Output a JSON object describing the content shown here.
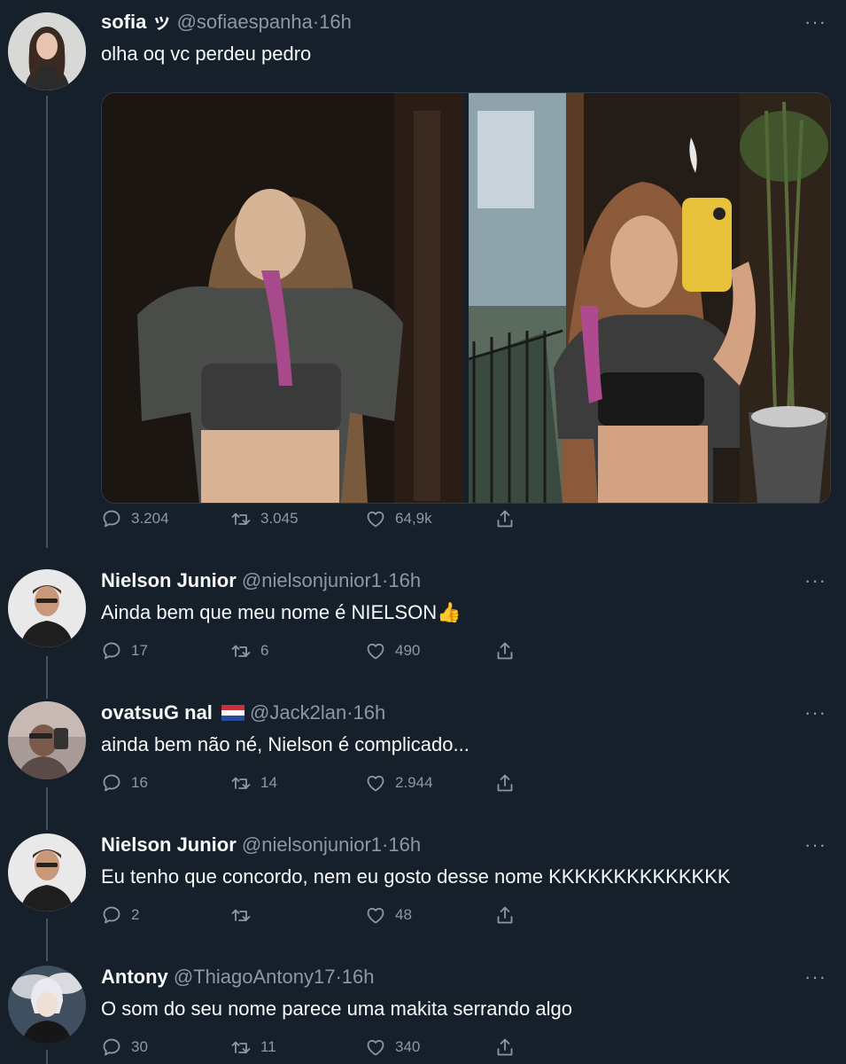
{
  "tweets": [
    {
      "name": "sofia ッ",
      "handle": "@sofiaespanha",
      "time": "16h",
      "text": "olha oq vc perdeu pedro",
      "replies": "3.204",
      "retweets": "3.045",
      "likes": "64,9k"
    },
    {
      "name": "Nielson Junior",
      "handle": "@nielsonjunior1",
      "time": "16h",
      "text": "Ainda bem que meu nome é NIELSON👍",
      "replies": "17",
      "retweets": "6",
      "likes": "490"
    },
    {
      "name": "ovatsuG nal",
      "handle": "@Jack2lan",
      "time": "16h",
      "text": "ainda bem não né, Nielson é complicado...",
      "replies": "16",
      "retweets": "14",
      "likes": "2.944"
    },
    {
      "name": "Nielson Junior",
      "handle": "@nielsonjunior1",
      "time": "16h",
      "text": "Eu tenho que concordo, nem eu gosto desse nome KKKKKKKKKKKKKK",
      "replies": "2",
      "retweets": "",
      "likes": "48"
    },
    {
      "name": "Antony",
      "handle": "@ThiagoAntony17",
      "time": "16h",
      "text": "O som do seu nome parece uma makita serrando algo",
      "replies": "30",
      "retweets": "11",
      "likes": "340"
    }
  ],
  "ui": {
    "dot": "·",
    "more": "···"
  },
  "colors": {
    "background": "#15202b",
    "secondary_text": "#8b98a5",
    "thread_line": "#3d5466"
  },
  "icons": [
    "reply-icon",
    "retweet-icon",
    "like-icon",
    "share-icon",
    "more-icon"
  ]
}
